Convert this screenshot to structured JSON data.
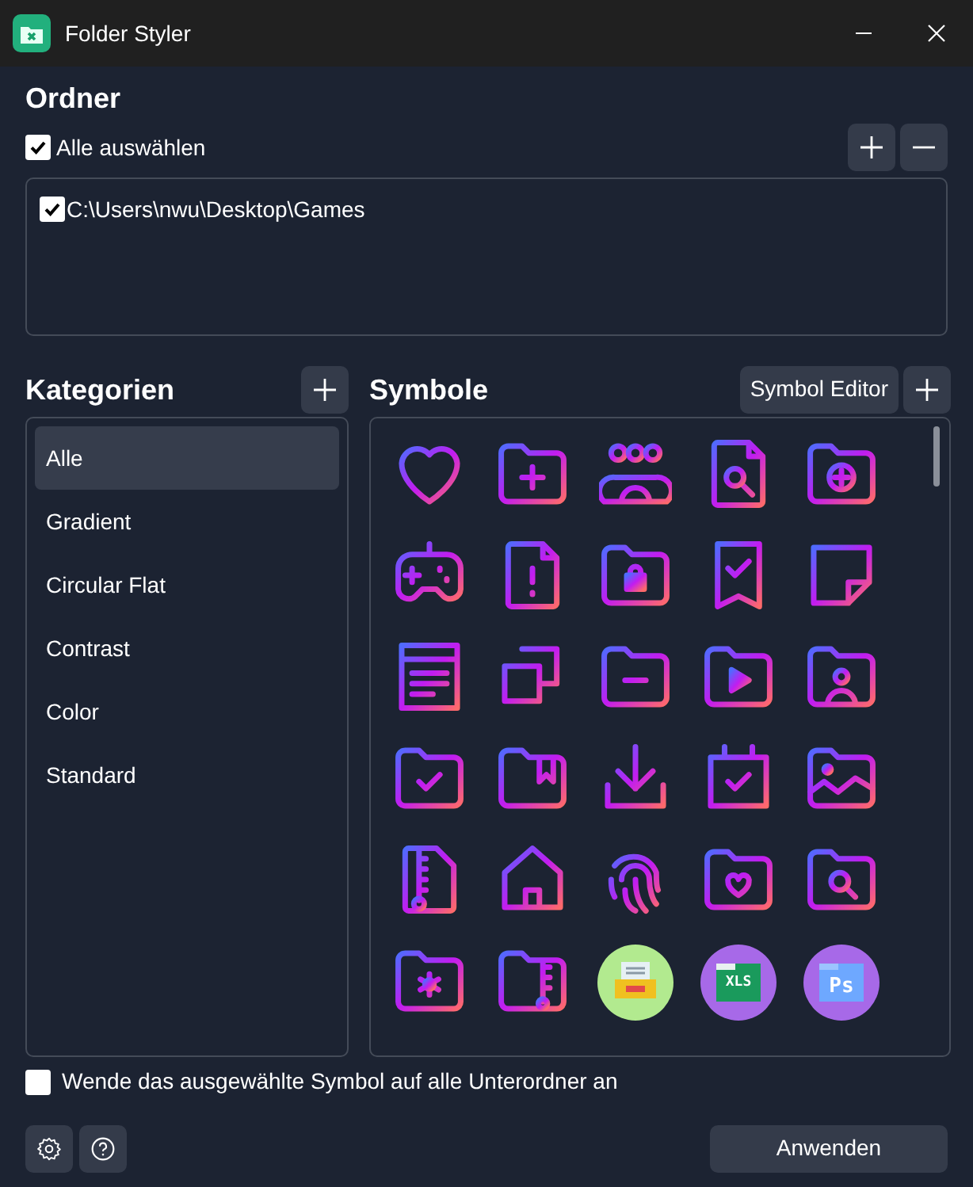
{
  "window": {
    "title": "Folder Styler"
  },
  "folders": {
    "heading": "Ordner",
    "select_all": {
      "label": "Alle auswählen",
      "checked": true
    },
    "items": [
      {
        "path": "C:\\Users\\nwu\\Desktop\\Games",
        "checked": true
      }
    ]
  },
  "categories": {
    "heading": "Kategorien",
    "items": [
      {
        "label": "Alle",
        "selected": true
      },
      {
        "label": "Gradient",
        "selected": false
      },
      {
        "label": "Circular Flat",
        "selected": false
      },
      {
        "label": "Contrast",
        "selected": false
      },
      {
        "label": "Color",
        "selected": false
      },
      {
        "label": "Standard",
        "selected": false
      }
    ]
  },
  "symbols": {
    "heading": "Symbole",
    "editor_button": "Symbol Editor",
    "items": [
      {
        "kind": "outline"
      },
      {
        "kind": "outline"
      },
      {
        "kind": "outline"
      },
      {
        "kind": "outline"
      },
      {
        "kind": "outline"
      },
      {
        "kind": "outline"
      },
      {
        "kind": "outline"
      },
      {
        "kind": "outline"
      },
      {
        "kind": "outline"
      },
      {
        "kind": "outline"
      },
      {
        "kind": "outline"
      },
      {
        "kind": "outline"
      },
      {
        "kind": "outline"
      },
      {
        "kind": "outline"
      },
      {
        "kind": "outline"
      },
      {
        "kind": "outline"
      },
      {
        "kind": "outline"
      },
      {
        "kind": "outline"
      },
      {
        "kind": "outline"
      },
      {
        "kind": "outline"
      },
      {
        "kind": "outline"
      },
      {
        "kind": "outline"
      },
      {
        "kind": "outline"
      },
      {
        "kind": "outline"
      },
      {
        "kind": "outline"
      },
      {
        "kind": "outline"
      },
      {
        "kind": "outline"
      },
      {
        "kind": "flat"
      },
      {
        "kind": "flat",
        "text": "XLS"
      },
      {
        "kind": "flat",
        "text": "Ps"
      }
    ]
  },
  "apply_subfolders": {
    "label": "Wende das ausgewählte Symbol auf alle Unterordner an",
    "checked": false
  },
  "apply_button": "Anwenden"
}
